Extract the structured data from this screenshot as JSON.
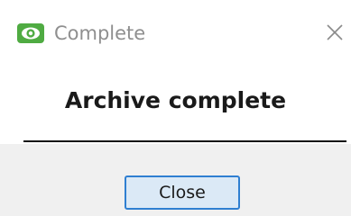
{
  "window": {
    "title": "Complete",
    "app_icon": "eye-logo-icon",
    "close_icon": "close-icon"
  },
  "content": {
    "message": "Archive complete"
  },
  "actions": {
    "close_label": "Close"
  },
  "colors": {
    "app_icon_bg": "#4fab42",
    "button_border": "#2f7fd1",
    "button_bg": "#dbe9f6",
    "dialog_bg": "#f0f0f0"
  }
}
